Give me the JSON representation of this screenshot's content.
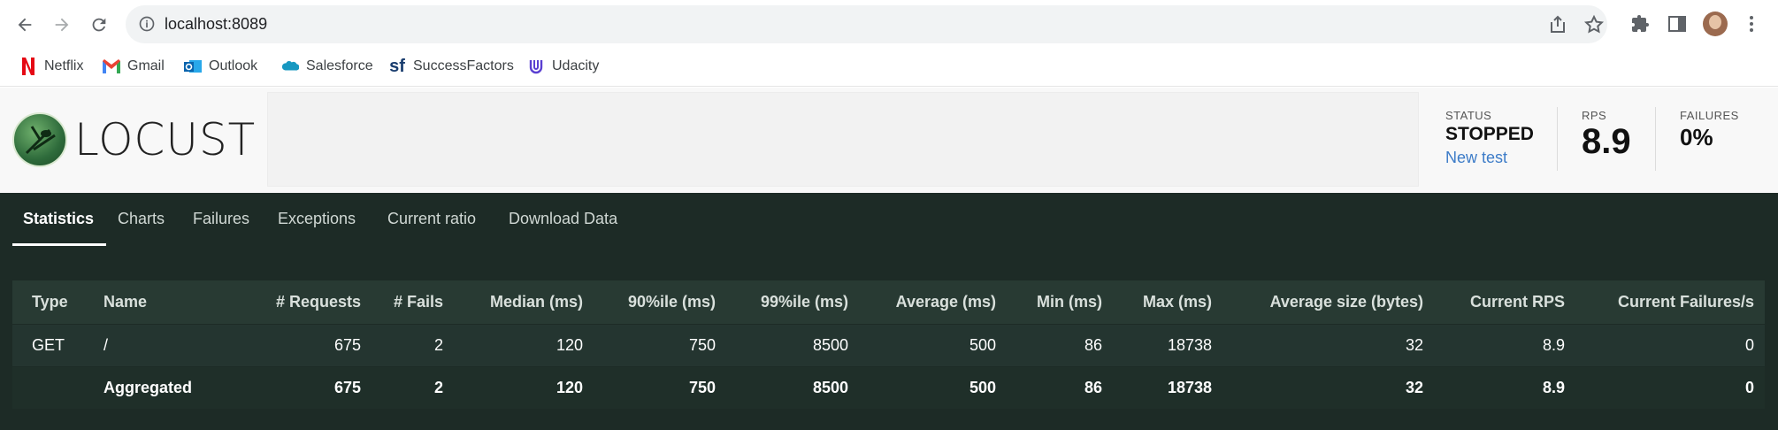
{
  "browser": {
    "url": "localhost:8089",
    "bookmarks": [
      {
        "label": "Netflix",
        "icon": "netflix-icon",
        "color": "#e50914"
      },
      {
        "label": "Gmail",
        "icon": "gmail-icon",
        "color": "#ea4335"
      },
      {
        "label": "Outlook",
        "icon": "outlook-icon",
        "color": "#0a64ad"
      },
      {
        "label": "Salesforce",
        "icon": "salesforce-icon",
        "color": "#1798c1"
      },
      {
        "label": "SuccessFactors",
        "icon": "successfactors-icon",
        "color": "#1a3d6e"
      },
      {
        "label": "Udacity",
        "icon": "udacity-icon",
        "color": "#5a3fd1"
      }
    ]
  },
  "app": {
    "logo_text": "LOCUST",
    "status_label": "STATUS",
    "status_value": "STOPPED",
    "new_test_link": "New test",
    "rps_label": "RPS",
    "rps_value": "8.9",
    "failures_label": "FAILURES",
    "failures_value": "0%"
  },
  "tabs": [
    "Statistics",
    "Charts",
    "Failures",
    "Exceptions",
    "Current ratio",
    "Download Data"
  ],
  "table": {
    "headers": [
      "Type",
      "Name",
      "# Requests",
      "# Fails",
      "Median (ms)",
      "90%ile (ms)",
      "99%ile (ms)",
      "Average (ms)",
      "Min (ms)",
      "Max (ms)",
      "Average size (bytes)",
      "Current RPS",
      "Current Failures/s"
    ],
    "rows": [
      [
        "GET",
        "/",
        "675",
        "2",
        "120",
        "750",
        "8500",
        "500",
        "86",
        "18738",
        "32",
        "8.9",
        "0"
      ],
      [
        "",
        "Aggregated",
        "675",
        "2",
        "120",
        "750",
        "8500",
        "500",
        "86",
        "18738",
        "32",
        "8.9",
        "0"
      ]
    ]
  },
  "colors": {
    "dark_bg": "#1d2b26",
    "link": "#3d7cc8"
  }
}
